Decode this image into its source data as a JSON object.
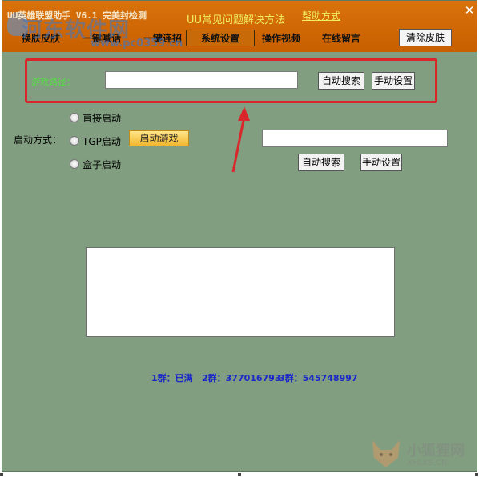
{
  "title": "UU英雄联盟助手 V6.1 完美封检测",
  "header": {
    "faq": "UU常见问题解决方法",
    "help": "帮助方式",
    "close_glyph": "✕"
  },
  "menu": [
    {
      "label": "换肤皮肤"
    },
    {
      "label": "一键喊话"
    },
    {
      "label": "一键连招"
    },
    {
      "label": "系统设置"
    },
    {
      "label": "操作视频"
    },
    {
      "label": "在线留言"
    }
  ],
  "skin_clear_button": "清除皮肤",
  "watermark": {
    "text": "河东软件网",
    "url": "www.pc0359.cn"
  },
  "game_path": {
    "label": "游戏路径：",
    "value": "",
    "auto_search": "自动搜索",
    "manual_set": "手动设置"
  },
  "launch": {
    "mode_label": "启动方式：",
    "options": [
      {
        "label": "直接启动"
      },
      {
        "label": "TGP启动"
      },
      {
        "label": "盒子启动"
      }
    ],
    "start_game": "启动游戏",
    "path_value": "",
    "auto_search": "自动搜索",
    "manual_set": "手动设置"
  },
  "groups": [
    {
      "text": "1群：已满"
    },
    {
      "text": "2群：377016793"
    },
    {
      "text": "3群：545748997"
    }
  ],
  "corner_watermark": {
    "text": "小狐狸网",
    "url": "XHLKS.CN"
  },
  "colors": {
    "window_bg": "#829e80",
    "titlebar": "#d9720c",
    "highlight": "#d9262a",
    "group_text": "#1a28c8"
  }
}
